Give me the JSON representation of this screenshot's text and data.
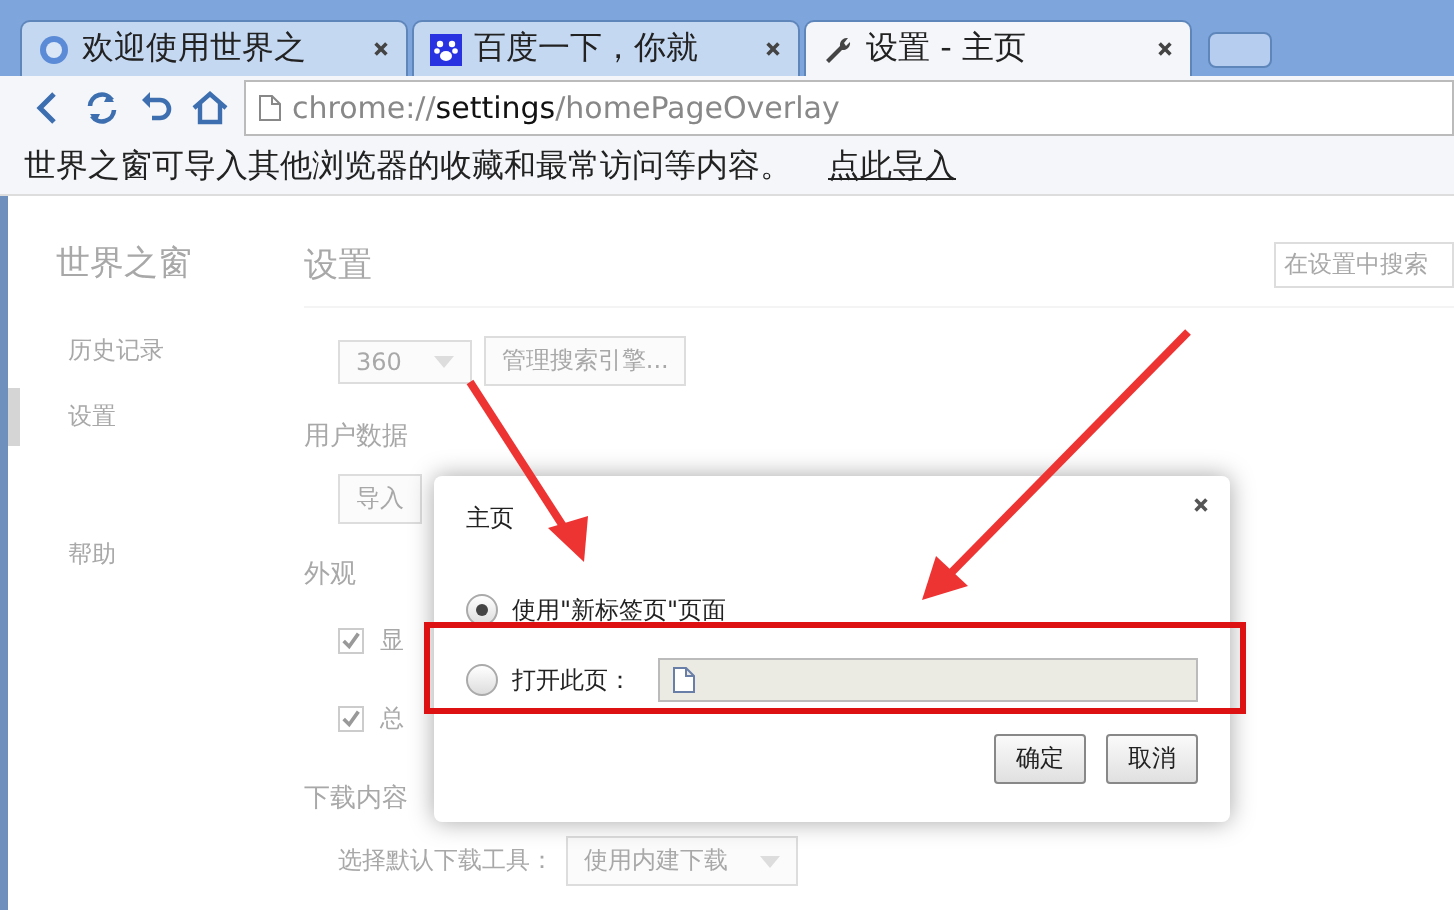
{
  "tabs": [
    {
      "title": "欢迎使用世界之",
      "selected": false
    },
    {
      "title": "百度一下，你就",
      "selected": false
    },
    {
      "title": "设置 - 主页",
      "selected": true
    }
  ],
  "address": {
    "scheme": "chrome://",
    "host": "settings",
    "path": "/homePageOverlay"
  },
  "infobar": {
    "message": "世界之窗可导入其他浏览器的收藏和最常访问等内容。",
    "link": "点此导入"
  },
  "sidebar": {
    "title": "世界之窗",
    "items": [
      {
        "label": "历史记录",
        "selected": false
      },
      {
        "label": "设置",
        "selected": true
      },
      {
        "label": "帮助",
        "selected": false
      }
    ]
  },
  "settings": {
    "title": "设置",
    "search_placeholder": "在设置中搜索",
    "engine": {
      "value": "360",
      "manage": "管理搜索引擎..."
    },
    "user_data": {
      "heading": "用户数据",
      "button": "导入"
    },
    "appearance": {
      "heading": "外观",
      "checks": [
        {
          "label": "显",
          "checked": true
        },
        {
          "label": "总",
          "checked": true
        }
      ]
    },
    "downloads": {
      "heading": "下载内容",
      "label": "选择默认下载工具：",
      "value": "使用内建下载"
    }
  },
  "dialog": {
    "title": "主页",
    "options": [
      {
        "kind": "plain",
        "label": "使用\"新标签页\"页面",
        "selected": true
      },
      {
        "kind": "url",
        "label": "打开此页：",
        "selected": false
      }
    ],
    "buttons": [
      "确定",
      "取消"
    ]
  }
}
